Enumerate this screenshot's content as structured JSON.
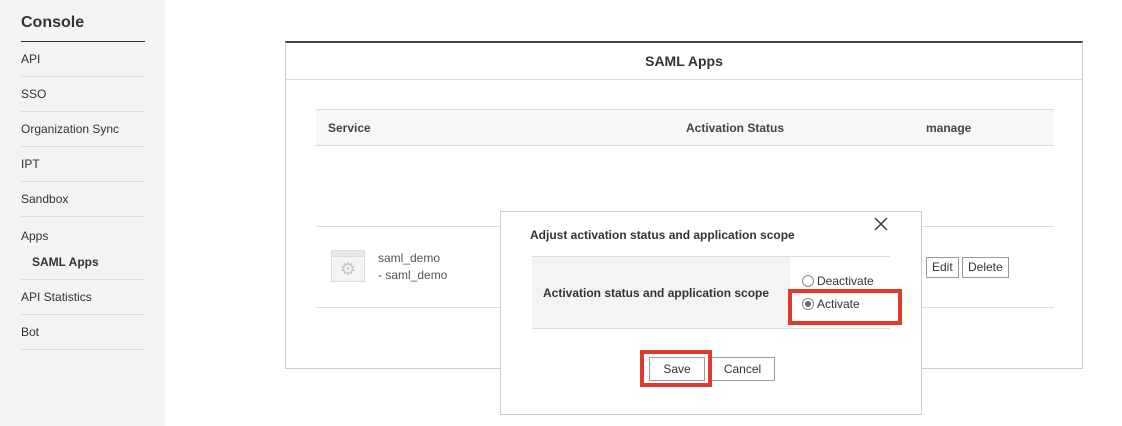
{
  "sidebar": {
    "title": "Console",
    "items": [
      {
        "label": "API"
      },
      {
        "label": "SSO"
      },
      {
        "label": "Organization Sync"
      },
      {
        "label": "IPT"
      },
      {
        "label": "Sandbox"
      },
      {
        "label": "Apps",
        "sub": "SAML Apps"
      },
      {
        "label": "API Statistics"
      },
      {
        "label": "Bot"
      }
    ]
  },
  "panel": {
    "title": "SAML Apps",
    "columns": {
      "service": "Service",
      "activation": "Activation Status",
      "manage": "manage"
    },
    "row": {
      "icon": "gear-icon",
      "name_line1": "saml_demo",
      "name_line2": "- saml_demo",
      "edit_label": "Edit",
      "delete_label": "Delete"
    }
  },
  "modal": {
    "title": "Adjust activation status and application scope",
    "field_label": "Activation status and application scope",
    "options": [
      {
        "label": "Deactivate",
        "selected": false
      },
      {
        "label": "Activate",
        "selected": true
      }
    ],
    "save_label": "Save",
    "cancel_label": "Cancel",
    "close_icon": "close-icon",
    "highlight_color": "#e03a2e"
  }
}
